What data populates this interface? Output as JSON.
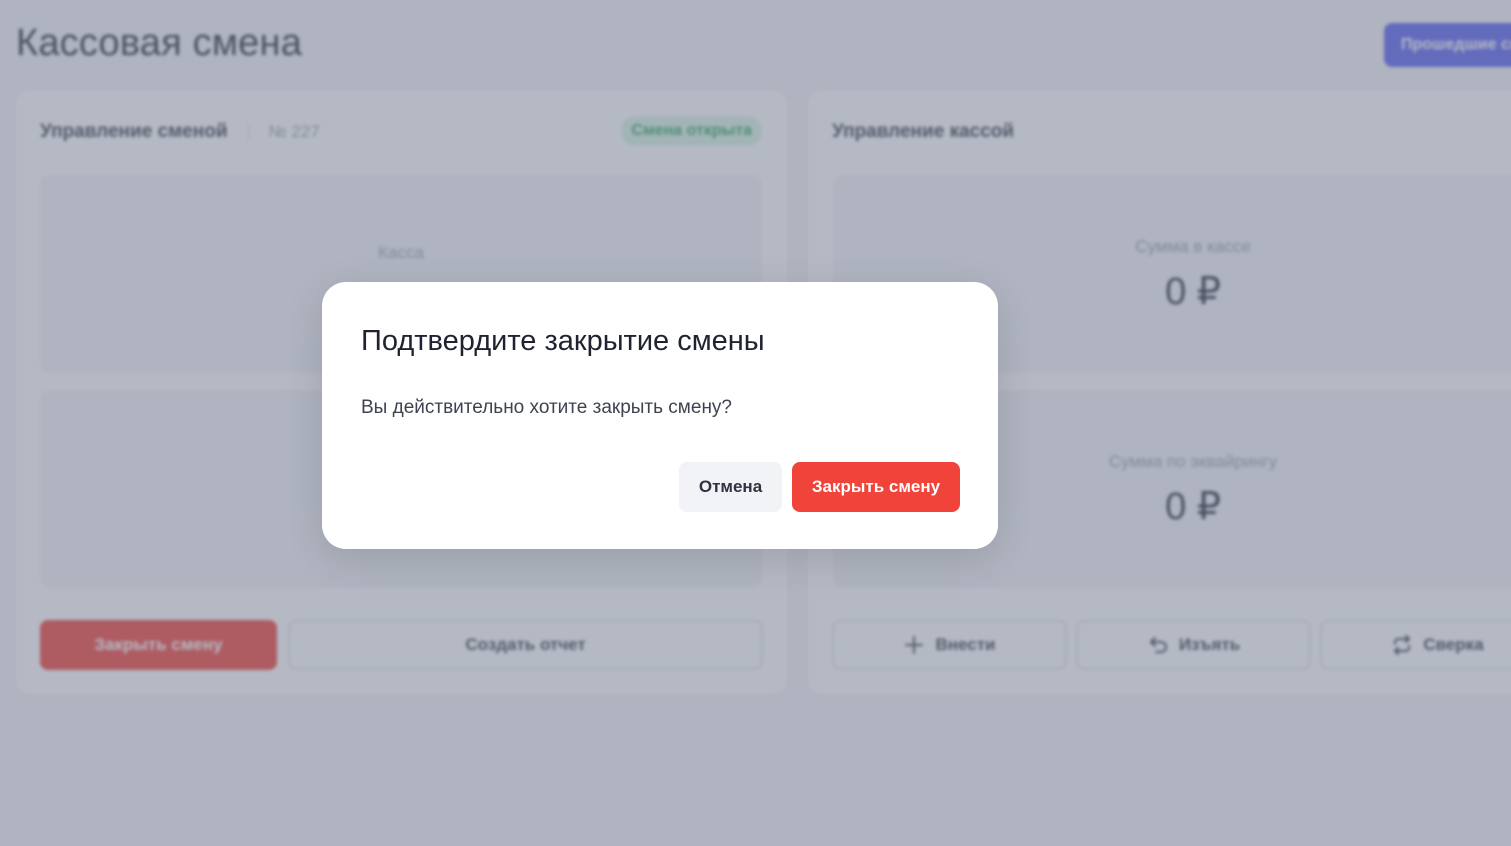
{
  "page": {
    "title": "Кассовая смена",
    "past_shifts_button": "Прошедшие смены"
  },
  "shift_card": {
    "title": "Управление сменой",
    "number": "№ 227",
    "status": "Смена открыта",
    "register_label": "Касса",
    "close_button": "Закрыть смену",
    "report_button": "Создать отчет"
  },
  "cash_card": {
    "title": "Управление кассой",
    "cash_sum_label": "Сумма в кассе",
    "cash_sum_value": "0 ₽",
    "acquiring_sum_label": "Сумма по эквайрингу",
    "acquiring_sum_value": "0 ₽",
    "deposit_button": "Внести",
    "withdraw_button": "Изъять",
    "reconcile_button": "Сверка"
  },
  "modal": {
    "title": "Подтвердите закрытие смены",
    "message": "Вы действительно хотите закрыть смену?",
    "cancel_button": "Отмена",
    "confirm_button": "Закрыть смену"
  },
  "colors": {
    "accent": "#5b63f0",
    "danger": "#f0443a",
    "success": "#36a866",
    "overlay": "#6c7489"
  },
  "icons": {
    "deposit": "plus-icon",
    "withdraw": "undo-icon",
    "reconcile": "repeat-icon"
  }
}
